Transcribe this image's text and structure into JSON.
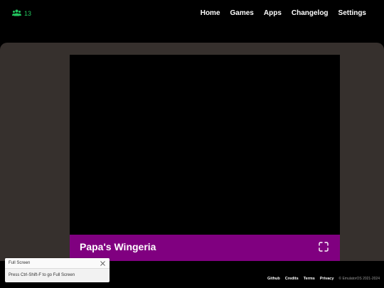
{
  "header": {
    "online_count": "13",
    "nav": {
      "home": "Home",
      "games": "Games",
      "apps": "Apps",
      "changelog": "Changelog",
      "settings": "Settings"
    }
  },
  "game": {
    "title": "Papa's Wingeria"
  },
  "footer": {
    "github": "Github",
    "credits": "Credits",
    "terms": "Terms",
    "privacy": "Privacy",
    "copyright": "© EmulatorOS 2021-2024"
  },
  "toast": {
    "title": "Full Screen",
    "message": "Press Ctrl-Shift-F to go Full Screen"
  },
  "colors": {
    "online_green": "#22c55e",
    "game_bar": "#800080",
    "panel": "#36302d"
  },
  "icons": [
    "users-icon",
    "fullscreen-icon",
    "close-icon"
  ]
}
